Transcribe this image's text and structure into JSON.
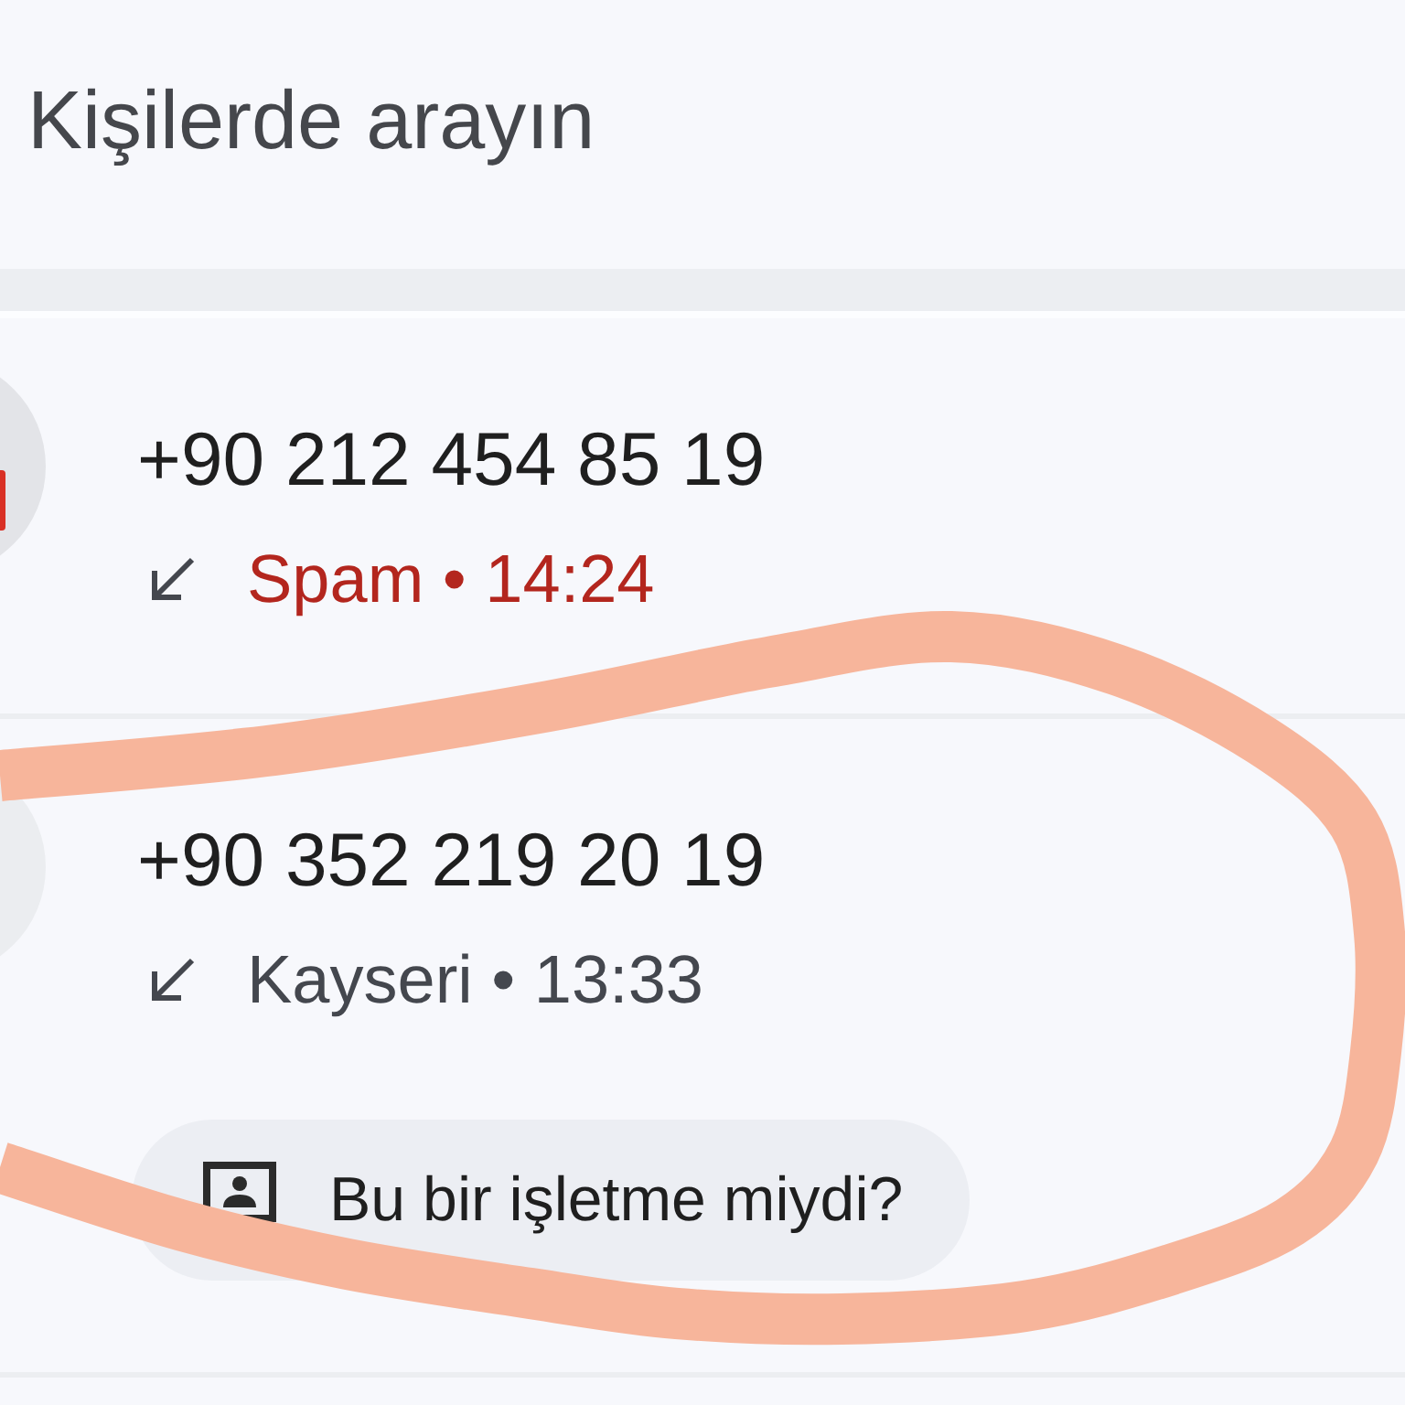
{
  "search": {
    "placeholder": "Kişilerde arayın"
  },
  "calls": [
    {
      "number": "+90 212 454 85 19",
      "detail": "Spam • 14:24",
      "spam": true
    },
    {
      "number": "+90 352 219 20 19",
      "detail": "Kayseri • 13:33",
      "spam": false,
      "action": "Bu bir işletme miydi?"
    }
  ]
}
